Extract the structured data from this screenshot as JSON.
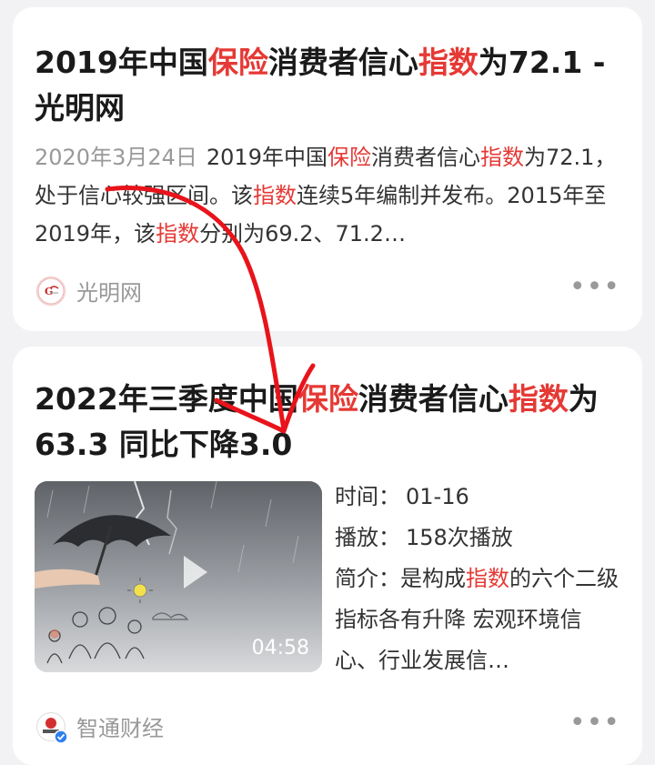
{
  "results": [
    {
      "title_parts": [
        "2019年中国",
        "保险",
        "消费者信心",
        "指数",
        "为72.1 - 光明网"
      ],
      "date": "2020年3月24日",
      "snippet_parts": [
        "2019年中国",
        "保险",
        "消费者信心",
        "指数",
        "为72.1，处于信心较强区间。该",
        "指数",
        "连续5年编制并发布。2015年至2019年，该",
        "指数",
        "分别为69.2、71.2…"
      ],
      "source": "光明网"
    },
    {
      "title_parts": [
        "2022年三季度中国",
        "保险",
        "消费者信心",
        "指数",
        "为63.3 同比下降3.0"
      ],
      "time_label": "时间：",
      "time_value": "01-16",
      "plays_label": "播放：",
      "plays_value": "158次播放",
      "intro_label": "简介：",
      "intro_parts": [
        "是构成",
        "指数",
        "的六个二级指标各有升降 宏观环境信心、行业发展信…"
      ],
      "duration": "04:58",
      "source": "智通财经"
    }
  ],
  "more_glyph": "•••",
  "icons": {
    "play": "play-icon",
    "more": "more-icon",
    "verified": "verified-badge-icon"
  },
  "colors": {
    "highlight": "#e53935",
    "annotation_arrow": "#e8141b"
  }
}
